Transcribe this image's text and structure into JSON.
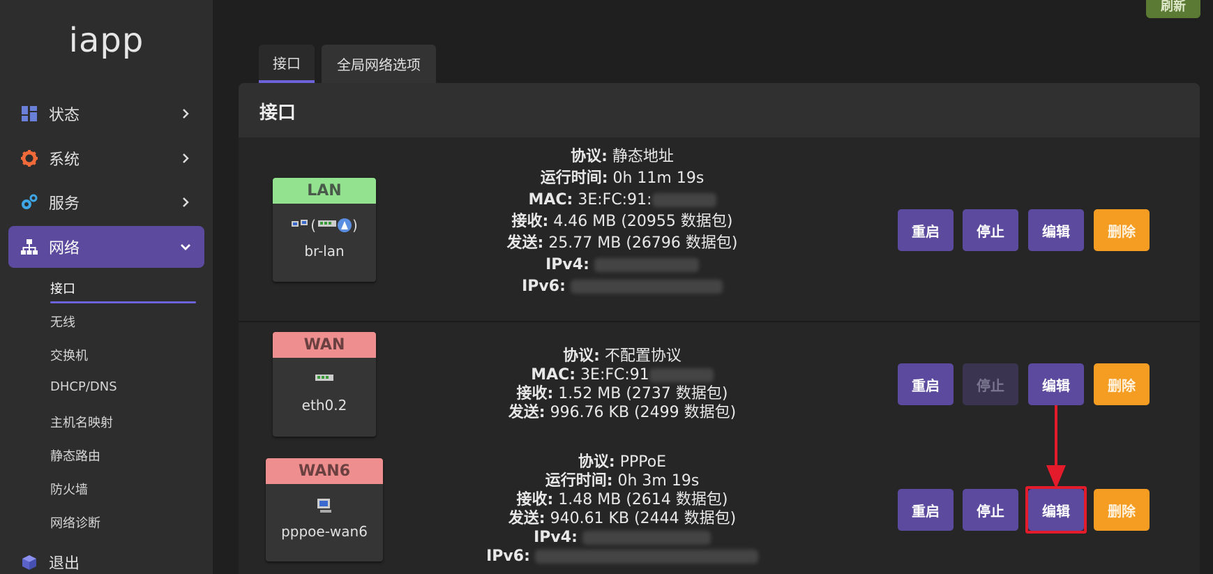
{
  "sidebar": {
    "brand": "iapp",
    "menu": [
      {
        "label": "状态",
        "icon": "dashboard-icon"
      },
      {
        "label": "系统",
        "icon": "gear-icon"
      },
      {
        "label": "服务",
        "icon": "services-icon"
      },
      {
        "label": "网络",
        "icon": "network-icon"
      }
    ],
    "submenu": [
      "接口",
      "无线",
      "交换机",
      "DHCP/DNS",
      "主机名映射",
      "静态路由",
      "防火墙",
      "网络诊断"
    ],
    "logout": {
      "label": "退出",
      "icon": "cube-icon"
    }
  },
  "header": {
    "refresh_label": "刷新"
  },
  "tabs": [
    {
      "label": "接口",
      "active": true
    },
    {
      "label": "全局网络选项",
      "active": false
    }
  ],
  "panel": {
    "title": "接口"
  },
  "interfaces": [
    {
      "name": "LAN",
      "device": "br-lan",
      "status_color": "#93e28f",
      "info": {
        "protocol_label": "协议:",
        "protocol": "静态地址",
        "uptime_label": "运行时间:",
        "uptime": "0h 11m 19s",
        "mac_label": "MAC:",
        "mac": "3E:FC:91:",
        "rx_label": "接收:",
        "rx": "4.46 MB (20955 数据包)",
        "tx_label": "发送:",
        "tx": "25.77 MB (26796 数据包)",
        "ipv4_label": "IPv4:",
        "ipv6_label": "IPv6:"
      },
      "buttons": {
        "restart": "重启",
        "stop": "停止",
        "edit": "编辑",
        "delete": "删除"
      }
    },
    {
      "name": "WAN",
      "device": "eth0.2",
      "status_color": "#ef8e8e",
      "info": {
        "protocol_label": "协议:",
        "protocol": "不配置协议",
        "mac_label": "MAC:",
        "mac": "3E:FC:91",
        "rx_label": "接收:",
        "rx": "1.52 MB (2737 数据包)",
        "tx_label": "发送:",
        "tx": "996.76 KB (2499 数据包)"
      },
      "buttons": {
        "restart": "重启",
        "stop": "停止",
        "edit": "编辑",
        "delete": "删除"
      }
    },
    {
      "name": "WAN6",
      "device": "pppoe-wan6",
      "status_color": "#ef8e8e",
      "info": {
        "protocol_label": "协议:",
        "protocol": "PPPoE",
        "uptime_label": "运行时间:",
        "uptime": "0h 3m 19s",
        "rx_label": "接收:",
        "rx": "1.48 MB (2614 数据包)",
        "tx_label": "发送:",
        "tx": "940.61 KB (2444 数据包)",
        "ipv4_label": "IPv4:",
        "ipv6_label": "IPv6:"
      },
      "buttons": {
        "restart": "重启",
        "stop": "停止",
        "edit": "编辑",
        "delete": "删除"
      }
    }
  ],
  "colors": {
    "accent": "#6c63d8",
    "button_purple": "#5b4a9e",
    "button_orange": "#f59d22",
    "highlight": "#e41b2a"
  }
}
